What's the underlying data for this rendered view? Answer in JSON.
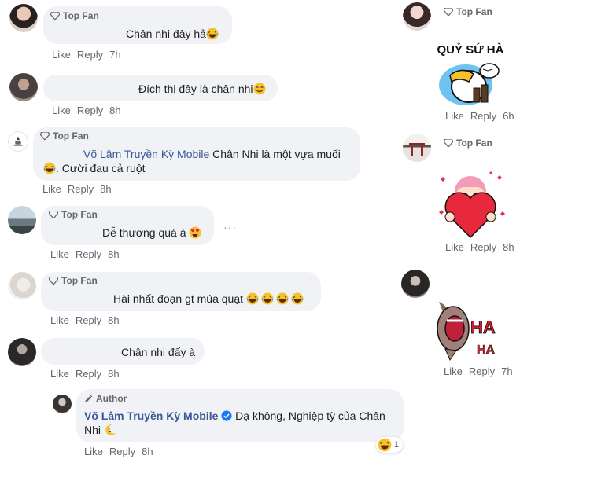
{
  "badges": {
    "top_fan": "Top Fan",
    "author": "Author"
  },
  "actions": {
    "like": "Like",
    "reply": "Reply"
  },
  "left_comments": [
    {
      "text": "Chân nhi đây hả",
      "time": "7h"
    },
    {
      "text": "Đích thị đây là chân nhi",
      "time": "8h"
    },
    {
      "mention": "Võ Lâm Truyền Kỳ Mobile",
      "text_line1": " Chân Nhi là một vựa muối",
      "text_line2": ". Cười đau cả ruột",
      "time": "8h"
    },
    {
      "text": "Dễ thương quá à ",
      "time": "8h"
    },
    {
      "text": "Hài nhất đoạn gt múa quạt ",
      "time": "8h"
    },
    {
      "text": "Chân nhi đấy à",
      "time": "8h"
    }
  ],
  "author_reply": {
    "name": "Võ Lâm Truyền Kỳ Mobile",
    "text_line1": "Dạ không, Nghiệp tỳ của Chân",
    "text_line2": "Nhi ",
    "reaction_count": "1",
    "time": "8h"
  },
  "right_comments": [
    {
      "sticker_text": "QUỶ SỨ HÀ",
      "time": "6h"
    },
    {
      "time": "8h"
    },
    {
      "sticker_text_1": "HA",
      "sticker_text_2": "HA",
      "time": "7h"
    }
  ],
  "more_icon": "···"
}
